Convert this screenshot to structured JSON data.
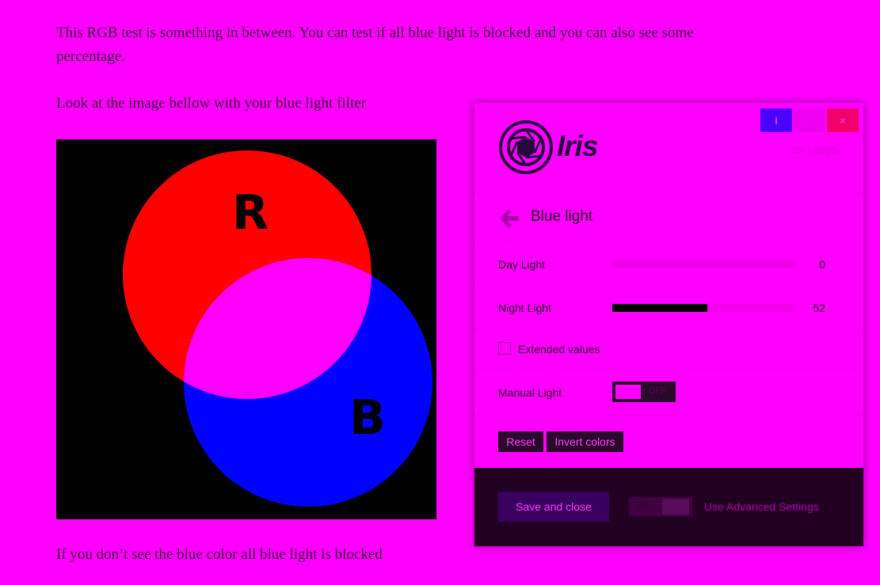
{
  "article": {
    "paragraph1": "This RGB test is something in between. You can test if all blue light is blocked and you can also see some percentage.",
    "paragraph2": "Look at the image bellow with your blue light filter",
    "paragraph3": "If you don’t see the blue color all blue light is blocked",
    "image_labels": {
      "red": "R",
      "blue": "B"
    },
    "colors": {
      "background": "#ff00ff",
      "red_circle": "#ff0000",
      "blue_circle": "#0000ff",
      "overlap": "#ff00ff"
    }
  },
  "iris": {
    "logo_text": "Iris",
    "status": "0K / 100%",
    "window_buttons": {
      "info": "i",
      "minimize": "_",
      "close": "×"
    },
    "section_title": "Blue light",
    "day_light": {
      "label": "Day Light",
      "value": "0",
      "fraction": 0
    },
    "night_light": {
      "label": "Night Light",
      "value": "52",
      "fraction": 0.52
    },
    "extended_values": {
      "label": "Extended values",
      "checked": false
    },
    "manual_light": {
      "label": "Manual Light",
      "state": "OFF"
    },
    "reset_label": "Reset",
    "invert_label": "Invert colors",
    "save_label": "Save and close",
    "advanced": {
      "toggle_state": "ON",
      "label": "Use Advanced Settings"
    }
  }
}
